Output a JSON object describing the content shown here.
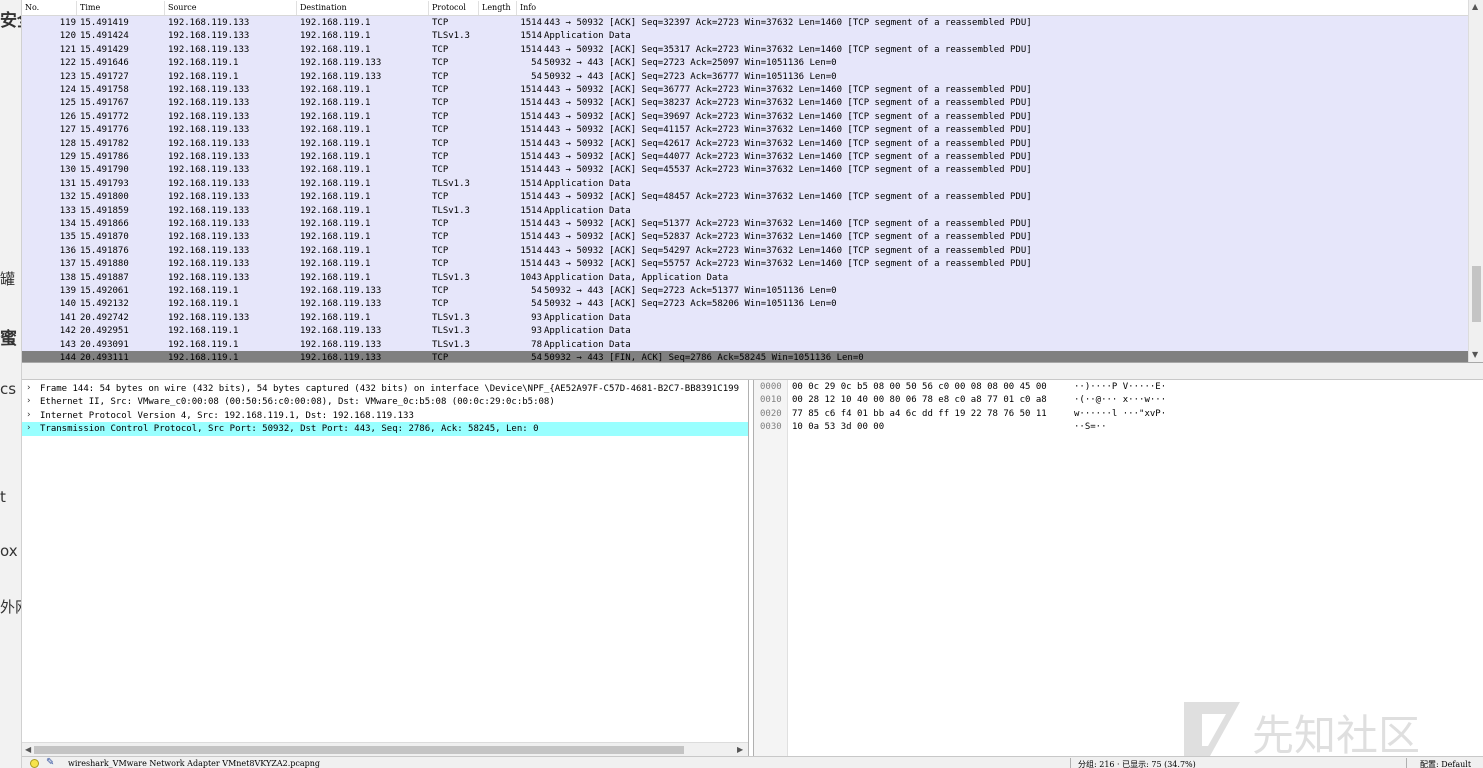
{
  "side_fragments": [
    "安全",
    "罐",
    "蜜",
    "cs",
    "t",
    "ox",
    "外网"
  ],
  "packet_list": {
    "columns": [
      "No.",
      "Time",
      "Source",
      "Destination",
      "Protocol",
      "Length",
      "Info"
    ],
    "rows": [
      {
        "no": "119",
        "time": "15.491419",
        "src": "192.168.119.133",
        "dst": "192.168.119.1",
        "proto": "TCP",
        "len": "1514",
        "info": "443 → 50932 [ACK] Seq=32397 Ack=2723 Win=37632 Len=1460 [TCP segment of a reassembled PDU]"
      },
      {
        "no": "120",
        "time": "15.491424",
        "src": "192.168.119.133",
        "dst": "192.168.119.1",
        "proto": "TLSv1.3",
        "len": "1514",
        "info": "Application Data"
      },
      {
        "no": "121",
        "time": "15.491429",
        "src": "192.168.119.133",
        "dst": "192.168.119.1",
        "proto": "TCP",
        "len": "1514",
        "info": "443 → 50932 [ACK] Seq=35317 Ack=2723 Win=37632 Len=1460 [TCP segment of a reassembled PDU]"
      },
      {
        "no": "122",
        "time": "15.491646",
        "src": "192.168.119.1",
        "dst": "192.168.119.133",
        "proto": "TCP",
        "len": "54",
        "info": "50932 → 443 [ACK] Seq=2723 Ack=25097 Win=1051136 Len=0"
      },
      {
        "no": "123",
        "time": "15.491727",
        "src": "192.168.119.1",
        "dst": "192.168.119.133",
        "proto": "TCP",
        "len": "54",
        "info": "50932 → 443 [ACK] Seq=2723 Ack=36777 Win=1051136 Len=0"
      },
      {
        "no": "124",
        "time": "15.491758",
        "src": "192.168.119.133",
        "dst": "192.168.119.1",
        "proto": "TCP",
        "len": "1514",
        "info": "443 → 50932 [ACK] Seq=36777 Ack=2723 Win=37632 Len=1460 [TCP segment of a reassembled PDU]"
      },
      {
        "no": "125",
        "time": "15.491767",
        "src": "192.168.119.133",
        "dst": "192.168.119.1",
        "proto": "TCP",
        "len": "1514",
        "info": "443 → 50932 [ACK] Seq=38237 Ack=2723 Win=37632 Len=1460 [TCP segment of a reassembled PDU]"
      },
      {
        "no": "126",
        "time": "15.491772",
        "src": "192.168.119.133",
        "dst": "192.168.119.1",
        "proto": "TCP",
        "len": "1514",
        "info": "443 → 50932 [ACK] Seq=39697 Ack=2723 Win=37632 Len=1460 [TCP segment of a reassembled PDU]"
      },
      {
        "no": "127",
        "time": "15.491776",
        "src": "192.168.119.133",
        "dst": "192.168.119.1",
        "proto": "TCP",
        "len": "1514",
        "info": "443 → 50932 [ACK] Seq=41157 Ack=2723 Win=37632 Len=1460 [TCP segment of a reassembled PDU]"
      },
      {
        "no": "128",
        "time": "15.491782",
        "src": "192.168.119.133",
        "dst": "192.168.119.1",
        "proto": "TCP",
        "len": "1514",
        "info": "443 → 50932 [ACK] Seq=42617 Ack=2723 Win=37632 Len=1460 [TCP segment of a reassembled PDU]"
      },
      {
        "no": "129",
        "time": "15.491786",
        "src": "192.168.119.133",
        "dst": "192.168.119.1",
        "proto": "TCP",
        "len": "1514",
        "info": "443 → 50932 [ACK] Seq=44077 Ack=2723 Win=37632 Len=1460 [TCP segment of a reassembled PDU]"
      },
      {
        "no": "130",
        "time": "15.491790",
        "src": "192.168.119.133",
        "dst": "192.168.119.1",
        "proto": "TCP",
        "len": "1514",
        "info": "443 → 50932 [ACK] Seq=45537 Ack=2723 Win=37632 Len=1460 [TCP segment of a reassembled PDU]"
      },
      {
        "no": "131",
        "time": "15.491793",
        "src": "192.168.119.133",
        "dst": "192.168.119.1",
        "proto": "TLSv1.3",
        "len": "1514",
        "info": "Application Data"
      },
      {
        "no": "132",
        "time": "15.491800",
        "src": "192.168.119.133",
        "dst": "192.168.119.1",
        "proto": "TCP",
        "len": "1514",
        "info": "443 → 50932 [ACK] Seq=48457 Ack=2723 Win=37632 Len=1460 [TCP segment of a reassembled PDU]"
      },
      {
        "no": "133",
        "time": "15.491859",
        "src": "192.168.119.133",
        "dst": "192.168.119.1",
        "proto": "TLSv1.3",
        "len": "1514",
        "info": "Application Data"
      },
      {
        "no": "134",
        "time": "15.491866",
        "src": "192.168.119.133",
        "dst": "192.168.119.1",
        "proto": "TCP",
        "len": "1514",
        "info": "443 → 50932 [ACK] Seq=51377 Ack=2723 Win=37632 Len=1460 [TCP segment of a reassembled PDU]"
      },
      {
        "no": "135",
        "time": "15.491870",
        "src": "192.168.119.133",
        "dst": "192.168.119.1",
        "proto": "TCP",
        "len": "1514",
        "info": "443 → 50932 [ACK] Seq=52837 Ack=2723 Win=37632 Len=1460 [TCP segment of a reassembled PDU]"
      },
      {
        "no": "136",
        "time": "15.491876",
        "src": "192.168.119.133",
        "dst": "192.168.119.1",
        "proto": "TCP",
        "len": "1514",
        "info": "443 → 50932 [ACK] Seq=54297 Ack=2723 Win=37632 Len=1460 [TCP segment of a reassembled PDU]"
      },
      {
        "no": "137",
        "time": "15.491880",
        "src": "192.168.119.133",
        "dst": "192.168.119.1",
        "proto": "TCP",
        "len": "1514",
        "info": "443 → 50932 [ACK] Seq=55757 Ack=2723 Win=37632 Len=1460 [TCP segment of a reassembled PDU]"
      },
      {
        "no": "138",
        "time": "15.491887",
        "src": "192.168.119.133",
        "dst": "192.168.119.1",
        "proto": "TLSv1.3",
        "len": "1043",
        "info": "Application Data, Application Data"
      },
      {
        "no": "139",
        "time": "15.492061",
        "src": "192.168.119.1",
        "dst": "192.168.119.133",
        "proto": "TCP",
        "len": "54",
        "info": "50932 → 443 [ACK] Seq=2723 Ack=51377 Win=1051136 Len=0"
      },
      {
        "no": "140",
        "time": "15.492132",
        "src": "192.168.119.1",
        "dst": "192.168.119.133",
        "proto": "TCP",
        "len": "54",
        "info": "50932 → 443 [ACK] Seq=2723 Ack=58206 Win=1051136 Len=0"
      },
      {
        "no": "141",
        "time": "20.492742",
        "src": "192.168.119.133",
        "dst": "192.168.119.1",
        "proto": "TLSv1.3",
        "len": "93",
        "info": "Application Data"
      },
      {
        "no": "142",
        "time": "20.492951",
        "src": "192.168.119.1",
        "dst": "192.168.119.133",
        "proto": "TLSv1.3",
        "len": "93",
        "info": "Application Data"
      },
      {
        "no": "143",
        "time": "20.493091",
        "src": "192.168.119.1",
        "dst": "192.168.119.133",
        "proto": "TLSv1.3",
        "len": "78",
        "info": "Application Data"
      },
      {
        "no": "144",
        "time": "20.493111",
        "src": "192.168.119.1",
        "dst": "192.168.119.133",
        "proto": "TCP",
        "len": "54",
        "info": "50932 → 443 [FIN, ACK] Seq=2786 Ack=58245 Win=1051136 Len=0",
        "selected": true
      }
    ]
  },
  "details": {
    "rows": [
      {
        "text": "Frame 144: 54 bytes on wire (432 bits), 54 bytes captured (432 bits) on interface \\Device\\NPF_{AE52A97F-C57D-4681-B2C7-BB8391C199",
        "selected": false
      },
      {
        "text": "Ethernet II, Src: VMware_c0:00:08 (00:50:56:c0:00:08), Dst: VMware_0c:b5:08 (00:0c:29:0c:b5:08)",
        "selected": false
      },
      {
        "text": "Internet Protocol Version 4, Src: 192.168.119.1, Dst: 192.168.119.133",
        "selected": false
      },
      {
        "text": "Transmission Control Protocol, Src Port: 50932, Dst Port: 443, Seq: 2786, Ack: 58245, Len: 0",
        "selected": true
      }
    ]
  },
  "bytes": {
    "rows": [
      {
        "offset": "0000",
        "hex": "00 0c 29 0c b5 08 00 50  56 c0 00 08 08 00 45 00",
        "ascii": "··)····P V·····E·"
      },
      {
        "offset": "0010",
        "hex": "00 28 12 10 40 00 80 06  78 e8 c0 a8 77 01 c0 a8",
        "ascii": "·(··@··· x···w···"
      },
      {
        "offset": "0020",
        "hex": "77 85 c6 f4 01 bb a4 6c  dd ff 19 22 78 76 50 11",
        "ascii": "w······l ···\"xvP·"
      },
      {
        "offset": "0030",
        "hex": "10 0a 53 3d 00 00",
        "ascii": "··S=··"
      }
    ]
  },
  "statusbar": {
    "file": "wireshark_VMware Network Adapter VMnet8VKYZA2.pcapng",
    "packets": "分组: 216 · 已显示: 75 (34.7%)",
    "profile": "配置: Default"
  },
  "watermark": {
    "text": "先知社区"
  },
  "colors": {
    "list_bg": "#e6e6fa",
    "selected_row": "#808080",
    "selected_detail": "#99ffff",
    "led": "#f6e34b"
  },
  "icons": [
    "caret-right-icon",
    "expert-led-icon",
    "edit-comment-icon",
    "scroll-up-icon",
    "scroll-down-icon",
    "scroll-left-icon",
    "scroll-right-icon"
  ]
}
